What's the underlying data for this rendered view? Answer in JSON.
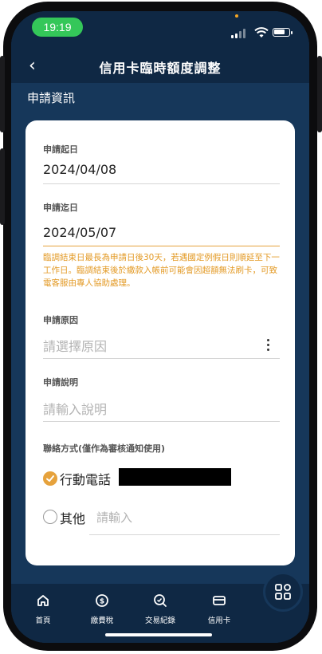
{
  "status_bar": {
    "time": "19:19"
  },
  "header": {
    "back_icon": "chevron-left-icon",
    "back_glyph": "‹",
    "title": "信用卡臨時額度調整"
  },
  "section": {
    "label": "申請資訊"
  },
  "form": {
    "start_date": {
      "label": "申請起日",
      "value": "2024/04/08"
    },
    "end_date": {
      "label": "申請迄日",
      "value": "2024/05/07"
    },
    "note": "臨調結束日最長為申請日後30天，若遇國定例假日則順延至下一工作日。臨調結束後於繳款入帳前可能會因超額無法刷卡，可致電客服由專人協助處理。",
    "reason": {
      "label": "申請原因",
      "placeholder": "請選擇原因"
    },
    "description": {
      "label": "申請說明",
      "placeholder": "請輸入說明"
    },
    "contact": {
      "label": "聯絡方式(僅作為審核通知使用)",
      "options": [
        {
          "label": "行動電話",
          "selected": true
        },
        {
          "label": "其他",
          "selected": false,
          "placeholder": "請輸入"
        }
      ]
    }
  },
  "bottom_nav": {
    "items": [
      {
        "label": "首頁",
        "icon": "home-icon"
      },
      {
        "label": "繳費稅",
        "icon": "dollar-coin-icon"
      },
      {
        "label": "交易紀錄",
        "icon": "search-history-icon"
      },
      {
        "label": "信用卡",
        "icon": "credit-card-icon"
      }
    ]
  },
  "colors": {
    "navy": "#0f2844",
    "accent": "#e6a23c",
    "status_green": "#34c759"
  }
}
